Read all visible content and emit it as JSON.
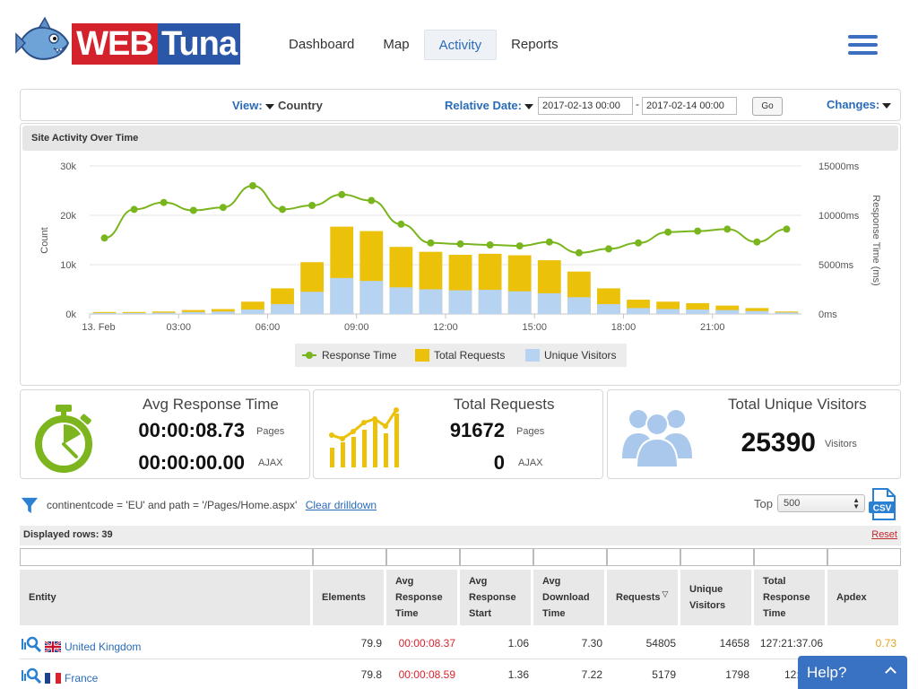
{
  "header": {
    "logo_left": "WEB",
    "logo_right": "Tuna",
    "nav": [
      {
        "label": "Dashboard",
        "active": false
      },
      {
        "label": "Map",
        "active": false
      },
      {
        "label": "Activity",
        "active": true
      },
      {
        "label": "Reports",
        "active": false
      }
    ]
  },
  "filterbar": {
    "view_label": "View:",
    "view_value": "Country",
    "relative_label": "Relative Date:",
    "date_from": "2017-02-13 00:00",
    "date_to": "2017-02-14 00:00",
    "dash": "-",
    "go_label": "Go",
    "changes_label": "Changes:"
  },
  "chart_panel": {
    "title": "Site Activity Over Time"
  },
  "chart_data": {
    "type": "bar",
    "title": "",
    "categories": [
      "00:00",
      "01:00",
      "02:00",
      "03:00",
      "04:00",
      "05:00",
      "06:00",
      "07:00",
      "08:00",
      "09:00",
      "10:00",
      "11:00",
      "12:00",
      "13:00",
      "14:00",
      "15:00",
      "16:00",
      "17:00",
      "18:00",
      "19:00",
      "20:00",
      "21:00",
      "22:00",
      "23:00"
    ],
    "x_tick_labels": [
      "13. Feb",
      "03:00",
      "06:00",
      "09:00",
      "12:00",
      "15:00",
      "18:00",
      "21:00"
    ],
    "x_tick_index": [
      0,
      3,
      6,
      9,
      12,
      15,
      18,
      21
    ],
    "series": [
      {
        "name": "Unique Visitors",
        "kind": "bar",
        "axis": "left",
        "color": "#b7d3f2",
        "values": [
          200,
          200,
          250,
          400,
          500,
          900,
          2000,
          4500,
          7300,
          6700,
          5400,
          5000,
          4800,
          4900,
          4600,
          4200,
          3400,
          2000,
          1200,
          1000,
          900,
          800,
          600,
          300
        ]
      },
      {
        "name": "Total Requests",
        "kind": "bar",
        "axis": "left",
        "color": "#ebc10a",
        "values": [
          400,
          400,
          500,
          800,
          1000,
          2500,
          5200,
          10500,
          17700,
          16800,
          13600,
          12600,
          12000,
          12200,
          11900,
          10900,
          8600,
          5200,
          2900,
          2500,
          2200,
          1700,
          1200,
          500
        ]
      },
      {
        "name": "Response Time",
        "kind": "line",
        "axis": "right",
        "color": "#79b51d",
        "values": [
          7700,
          10600,
          11300,
          10500,
          10800,
          13000,
          10600,
          11000,
          12100,
          11500,
          9100,
          7200,
          7100,
          7000,
          6900,
          7300,
          6200,
          6600,
          7200,
          8300,
          8400,
          8600,
          7300,
          8600
        ]
      }
    ],
    "ylabel_left": "Count",
    "ylabel_right": "Response Time (ms)",
    "ylim_left": [
      0,
      30000
    ],
    "ylim_right": [
      0,
      15000
    ],
    "left_ticks": [
      "0k",
      "10k",
      "20k",
      "30k"
    ],
    "right_ticks": [
      "0ms",
      "5000ms",
      "10000ms",
      "15000ms"
    ],
    "grid": true,
    "legend": "bottom-center"
  },
  "cards": {
    "avg_response": {
      "title": "Avg Response Time",
      "pages_value": "00:00:08.73",
      "pages_label": "Pages",
      "ajax_value": "00:00:00.00",
      "ajax_label": "AJAX"
    },
    "total_requests": {
      "title": "Total Requests",
      "pages_value": "91672",
      "pages_label": "Pages",
      "ajax_value": "0",
      "ajax_label": "AJAX"
    },
    "unique_visitors": {
      "title": "Total Unique Visitors",
      "value": "25390",
      "label": "Visitors"
    }
  },
  "drilldown": {
    "text": "continentcode = 'EU' and path = '/Pages/Home.aspx'",
    "clear_label": "Clear drilldown",
    "top_label": "Top",
    "top_value": "500",
    "csv_label": "CSV"
  },
  "rows": {
    "displayed": "Displayed rows: 39",
    "reset": "Reset"
  },
  "table": {
    "columns": [
      "Entity",
      "Elements",
      "Avg Response Time",
      "Avg Response Start",
      "Avg Download Time",
      "Requests",
      "Unique Visitors",
      "Total Response Time",
      "Apdex"
    ],
    "sort_marker": "▽",
    "rows": [
      {
        "entity": "United Kingdom",
        "flag": "uk",
        "elements": "79.9",
        "avg_response": "00:00:08.37",
        "avg_start": "1.06",
        "avg_download": "7.30",
        "requests": "54805",
        "unique": "14658",
        "total_time": "127:21:37.06",
        "apdex": "0.73"
      },
      {
        "entity": "France",
        "flag": "fr",
        "elements": "79.8",
        "avg_response": "00:00:08.59",
        "avg_start": "1.36",
        "avg_download": "7.22",
        "requests": "5179",
        "unique": "1798",
        "total_time": "12:21:",
        "apdex": ""
      }
    ]
  },
  "help": {
    "label": "Help?"
  }
}
